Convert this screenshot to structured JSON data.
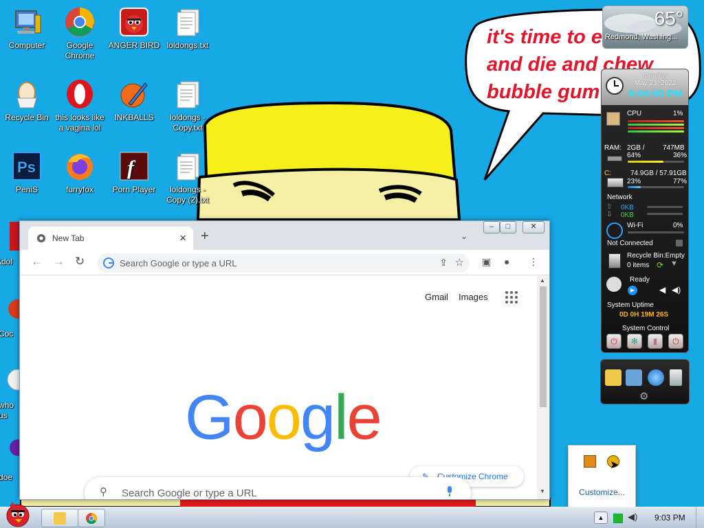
{
  "desktop": {
    "icons": [
      {
        "label": "Computer"
      },
      {
        "label": "Google Chrome"
      },
      {
        "label": "ANGER BIRD"
      },
      {
        "label": "loldongs.txt"
      },
      {
        "label": "Recycle Bin"
      },
      {
        "label": "this looks like a vagina lol"
      },
      {
        "label": "INKBALLS"
      },
      {
        "label": "loldongs - Copy.txt"
      },
      {
        "label": "PeniS"
      },
      {
        "label": "furryfox"
      },
      {
        "label": "Porn Player"
      },
      {
        "label": "loldongs - Copy (2).txt"
      },
      {
        "label": "Adol"
      },
      {
        "label": "Coc"
      },
      {
        "label": "who us"
      },
      {
        "label": "doe"
      }
    ]
  },
  "wallpaper": {
    "bubble_text": "it's time to e\nand die and chew\nbubble gum"
  },
  "weather": {
    "temp": "65°",
    "location": "Redmond, Washing..."
  },
  "sysmon": {
    "day": "Monday",
    "date": "May 23, 2022",
    "time": "9:04:00 PM",
    "cpu_label": "CPU",
    "cpu_pct": "1%",
    "ram_label": "RAM:",
    "ram_total": "2GB /",
    "ram_free": "747MB",
    "ram_used_pct": "64%",
    "ram_free_pct": "36%",
    "disk_c": "C:",
    "disk_sizes": "74.9GB / 57.91GB",
    "disk_used_pct": "23%",
    "disk_free_pct": "77%",
    "network_label": "Network",
    "net_up": "0KB",
    "net_down": "0KB",
    "wifi_label": "Wi-Fi",
    "wifi_pct": "0%",
    "wifi_status": "Not Connected",
    "recycle_label": "Recycle Bin:Empty",
    "recycle_items": "0 items",
    "media_status": "Ready",
    "uptime_label": "System Uptime",
    "uptime_value": "0D 0H 19M 26S",
    "control_label": "System Control"
  },
  "tray_popup": {
    "customize": "Customize..."
  },
  "chrome": {
    "tab_title": "New Tab",
    "new_tab": "+",
    "omnibox_placeholder": "Search Google or type a URL",
    "gmail": "Gmail",
    "images": "Images",
    "logo": [
      "G",
      "o",
      "o",
      "g",
      "l",
      "e"
    ],
    "logo_colors": [
      "#4285f4",
      "#ea4335",
      "#fbbc05",
      "#4285f4",
      "#34a853",
      "#ea4335"
    ],
    "customize_label": "Customize Chrome",
    "search_placeholder": "Search Google or type a URL"
  },
  "taskbar": {
    "clock": "9:03 PM"
  }
}
